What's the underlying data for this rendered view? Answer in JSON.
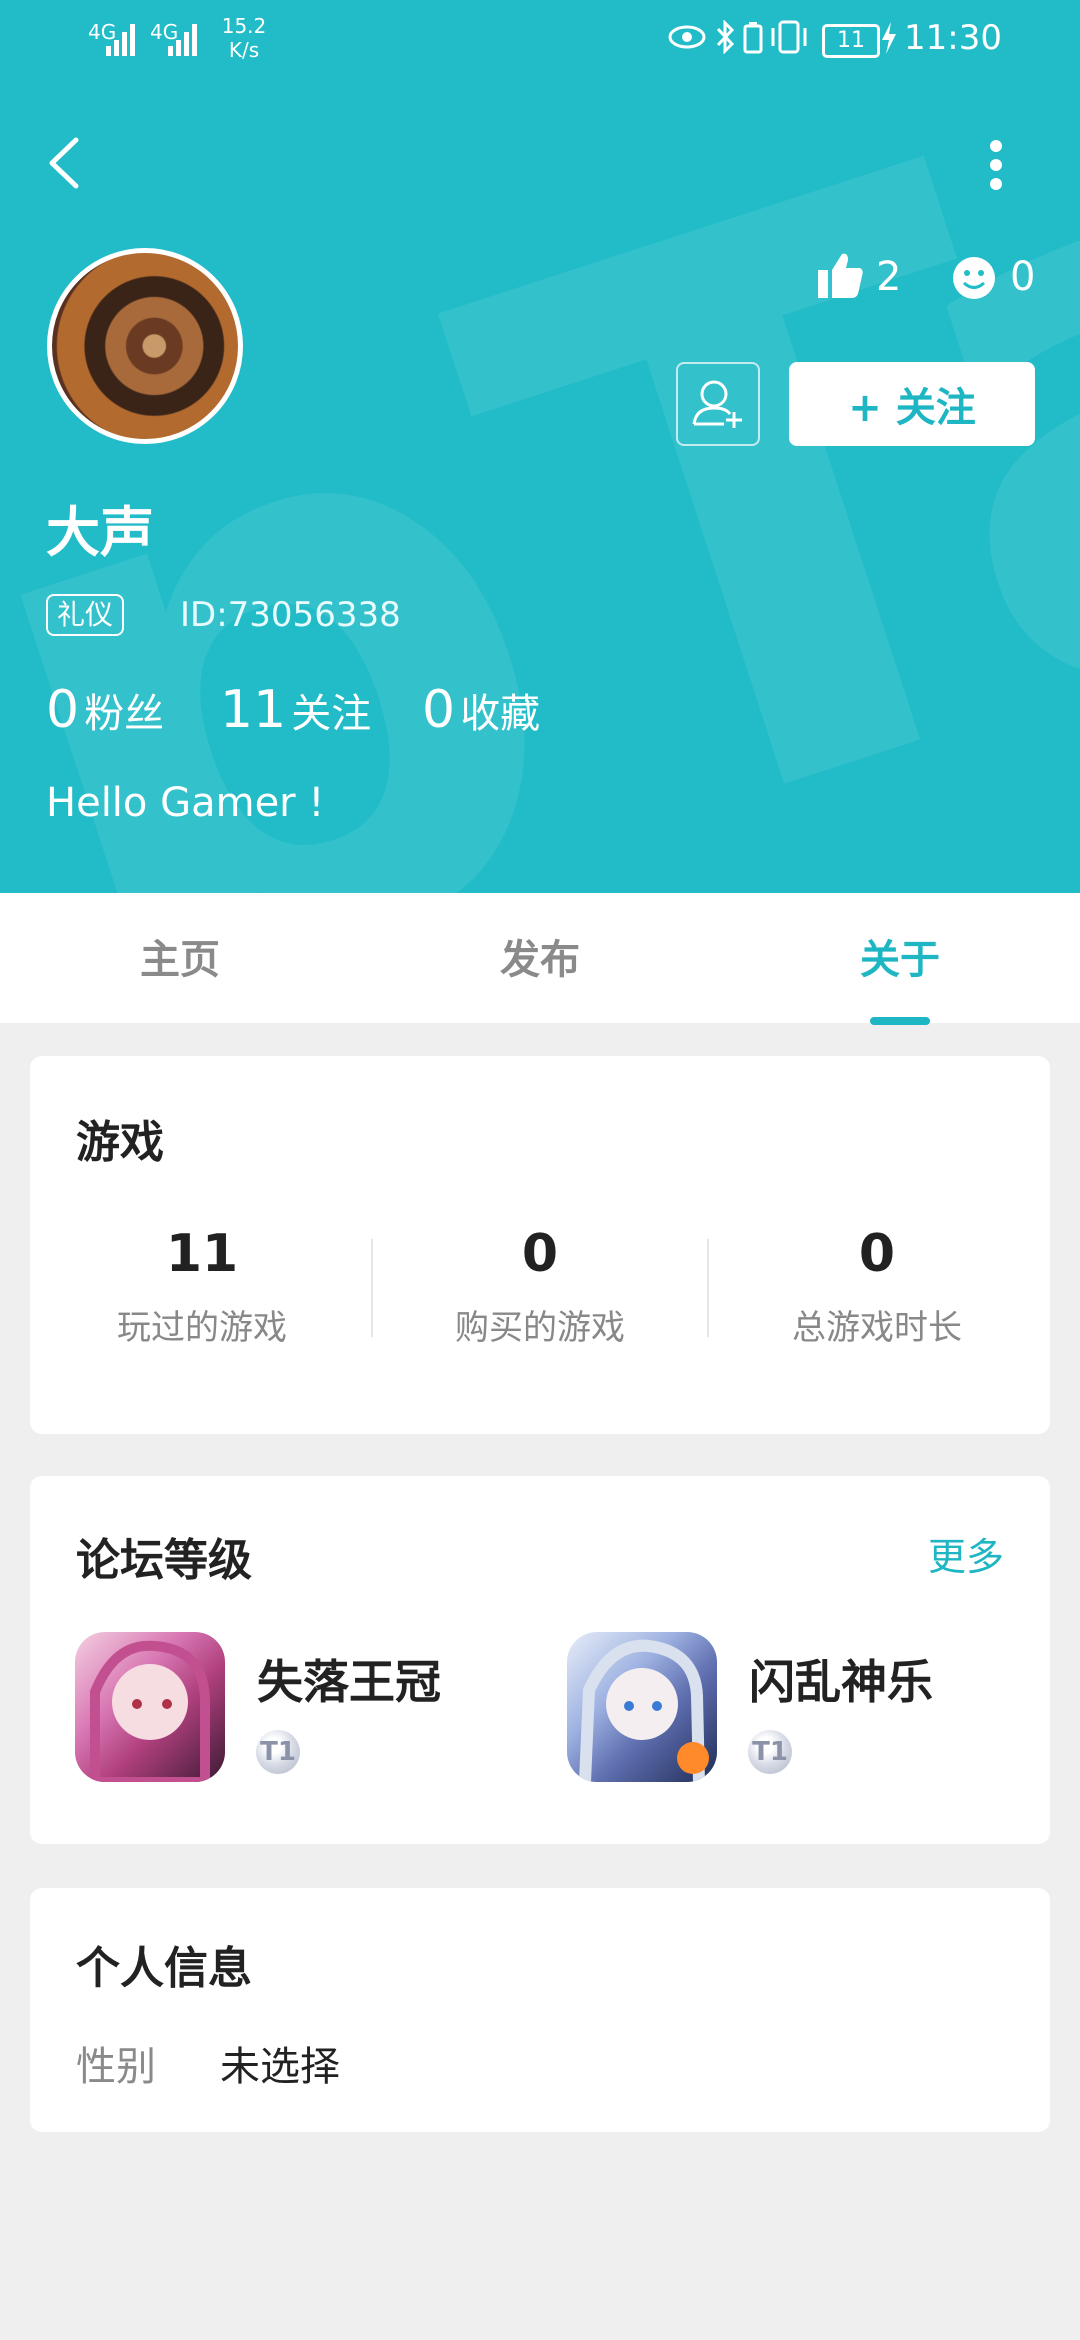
{
  "status_bar": {
    "network1": "4G",
    "network2": "4G",
    "speed_value": "15.2",
    "speed_unit": "K/s",
    "battery": "11",
    "time": "11:30"
  },
  "profile": {
    "likes": "2",
    "smiles": "0",
    "follow_label": "+ 关注",
    "name": "大声",
    "tag": "礼仪",
    "id_text": "ID:73056338",
    "fans_count": "0",
    "fans_label": "粉丝",
    "following_count": "11",
    "following_label": "关注",
    "favorites_count": "0",
    "favorites_label": "收藏",
    "bio": "Hello Gamer !"
  },
  "tabs": [
    {
      "label": "主页"
    },
    {
      "label": "发布"
    },
    {
      "label": "关于"
    }
  ],
  "games_card": {
    "title": "游戏",
    "stats": [
      {
        "value": "11",
        "label": "玩过的游戏"
      },
      {
        "value": "0",
        "label": "购买的游戏"
      },
      {
        "value": "0",
        "label": "总游戏时长"
      }
    ]
  },
  "forum_card": {
    "title": "论坛等级",
    "more": "更多",
    "games": [
      {
        "name": "失落王冠",
        "level": "T1"
      },
      {
        "name": "闪乱神乐",
        "level": "T1"
      }
    ]
  },
  "info_card": {
    "title": "个人信息",
    "gender_label": "性别",
    "gender_value": "未选择"
  },
  "colors": {
    "accent": "#1db6c2",
    "header_bg": "#21bcc8",
    "page_bg": "#efefef"
  }
}
